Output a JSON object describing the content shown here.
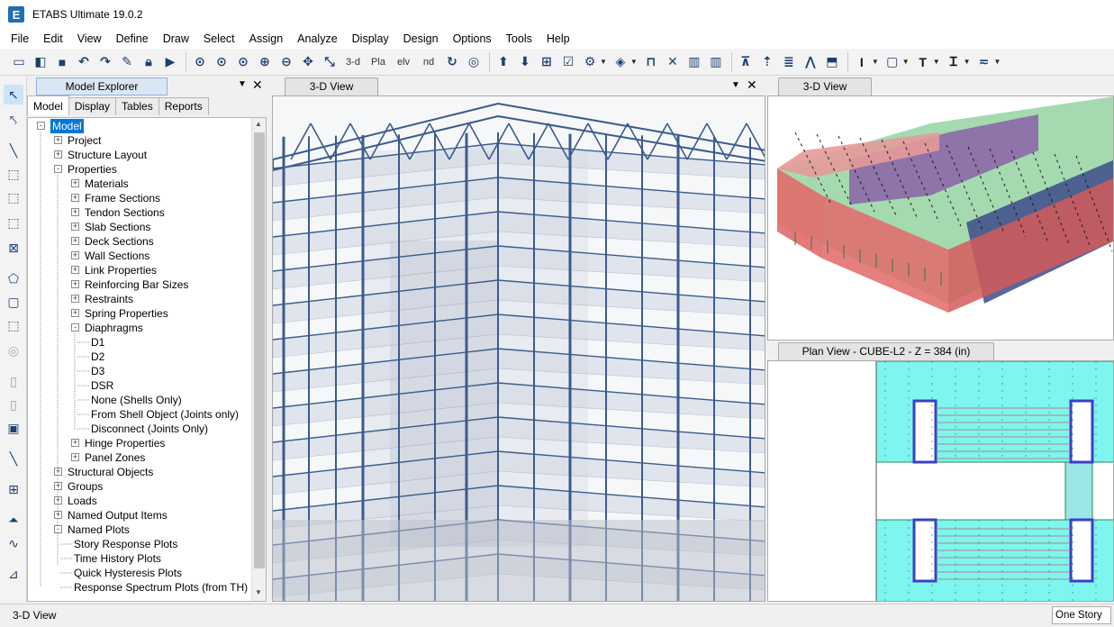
{
  "window": {
    "title": "ETABS Ultimate 19.0.2",
    "icon_letter": "E"
  },
  "menu": [
    "File",
    "Edit",
    "View",
    "Define",
    "Draw",
    "Select",
    "Assign",
    "Analyze",
    "Display",
    "Design",
    "Options",
    "Tools",
    "Help"
  ],
  "toolbar": {
    "btn_3d": "3-d",
    "btn_pla": "Pla",
    "btn_elv": "elv",
    "btn_nd": "nd"
  },
  "explorer": {
    "title": "Model Explorer",
    "tabs": [
      "Model",
      "Display",
      "Tables",
      "Reports"
    ],
    "tree": [
      {
        "label": "Model",
        "box": "-"
      },
      {
        "label": "Project",
        "box": "+"
      },
      {
        "label": "Structure Layout",
        "box": "+"
      },
      {
        "label": "Properties",
        "box": "-"
      },
      {
        "label": "Materials",
        "box": "+"
      },
      {
        "label": "Frame Sections",
        "box": "+"
      },
      {
        "label": "Tendon Sections",
        "box": "+"
      },
      {
        "label": "Slab Sections",
        "box": "+"
      },
      {
        "label": "Deck Sections",
        "box": "+"
      },
      {
        "label": "Wall Sections",
        "box": "+"
      },
      {
        "label": "Link Properties",
        "box": "+"
      },
      {
        "label": "Reinforcing Bar Sizes",
        "box": "+"
      },
      {
        "label": "Restraints",
        "box": "+"
      },
      {
        "label": "Spring Properties",
        "box": "+"
      },
      {
        "label": "Diaphragms",
        "box": "-"
      },
      {
        "label": "D1",
        "box": ""
      },
      {
        "label": "D2",
        "box": ""
      },
      {
        "label": "D3",
        "box": ""
      },
      {
        "label": "DSR",
        "box": ""
      },
      {
        "label": "None (Shells Only)",
        "box": ""
      },
      {
        "label": "From Shell Object (Joints only)",
        "box": ""
      },
      {
        "label": "Disconnect (Joints Only)",
        "box": ""
      },
      {
        "label": "Hinge Properties",
        "box": "+"
      },
      {
        "label": "Panel Zones",
        "box": "+"
      },
      {
        "label": "Structural Objects",
        "box": "+"
      },
      {
        "label": "Groups",
        "box": "+"
      },
      {
        "label": "Loads",
        "box": "+"
      },
      {
        "label": "Named Output Items",
        "box": "+"
      },
      {
        "label": "Named Plots",
        "box": "-"
      },
      {
        "label": "Story Response Plots",
        "box": ""
      },
      {
        "label": "Time History Plots",
        "box": ""
      },
      {
        "label": "Quick Hysteresis Plots",
        "box": ""
      },
      {
        "label": "Response Spectrum Plots (from TH)",
        "box": ""
      }
    ]
  },
  "views": {
    "main": {
      "title": "3-D View"
    },
    "top_right": {
      "title": "3-D View"
    },
    "plan": {
      "title": "Plan View - CUBE-L2 - Z = 384 (in)"
    }
  },
  "status": {
    "left": "3-D View",
    "right": "One Story"
  },
  "colors": {
    "accent": "#0078d7",
    "frame": "#3b5b8c",
    "slab_cyan": "#7ef5ee",
    "wall_red": "#e26a6a"
  }
}
